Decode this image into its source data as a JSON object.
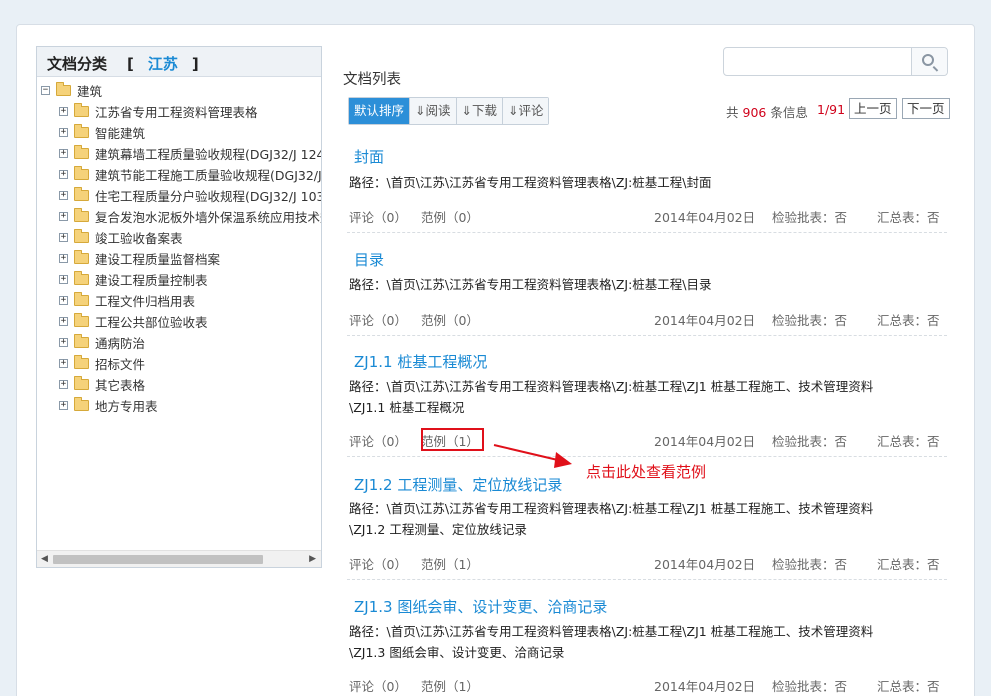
{
  "sidebar": {
    "heading": "文档分类",
    "bracket_open": "[",
    "province": "江苏",
    "bracket_close": "]",
    "root": {
      "label": "建筑",
      "toggle": "−"
    },
    "items": [
      {
        "label": "江苏省专用工程资料管理表格",
        "toggle": "+"
      },
      {
        "label": "智能建筑",
        "toggle": "+"
      },
      {
        "label": "建筑幕墙工程质量验收规程(DGJ32/J 124",
        "toggle": "+"
      },
      {
        "label": "建筑节能工程施工质量验收规程(DGJ32/J",
        "toggle": "+"
      },
      {
        "label": "住宅工程质量分户验收规程(DGJ32/J 103",
        "toggle": "+"
      },
      {
        "label": "复合发泡水泥板外墙外保温系统应用技术规",
        "toggle": "+"
      },
      {
        "label": "竣工验收备案表",
        "toggle": "+"
      },
      {
        "label": "建设工程质量监督档案",
        "toggle": "+"
      },
      {
        "label": "建设工程质量控制表",
        "toggle": "+"
      },
      {
        "label": "工程文件归档用表",
        "toggle": "+"
      },
      {
        "label": "工程公共部位验收表",
        "toggle": "+"
      },
      {
        "label": "通病防治",
        "toggle": "+"
      },
      {
        "label": "招标文件",
        "toggle": "+"
      },
      {
        "label": "其它表格",
        "toggle": "+"
      },
      {
        "label": "地方专用表",
        "toggle": "+"
      }
    ],
    "scroll_left": "◀",
    "scroll_right": "▶"
  },
  "main": {
    "title": "文档列表",
    "search": {
      "placeholder": "",
      "value": ""
    },
    "sort_tabs": [
      {
        "label": "默认排序"
      },
      {
        "label": "⇓阅读"
      },
      {
        "label": "⇓下载"
      },
      {
        "label": "⇓评论"
      }
    ],
    "pager": {
      "prefix": "共",
      "total": "906",
      "suffix": "条信息",
      "page": "1/91",
      "prev": "上一页",
      "next": "下一页"
    },
    "documents": [
      {
        "title": "封面",
        "path_lines": [
          "路径：\\首页\\江苏\\江苏省专用工程资料管理表格\\ZJ:桩基工程\\封面"
        ],
        "comments": "评论（0）",
        "examples": "范例（0）",
        "date": "2014年04月02日",
        "check": "检验批表：否",
        "summary": "汇总表：否"
      },
      {
        "title": "目录",
        "path_lines": [
          "路径：\\首页\\江苏\\江苏省专用工程资料管理表格\\ZJ:桩基工程\\目录"
        ],
        "comments": "评论（0）",
        "examples": "范例（0）",
        "date": "2014年04月02日",
        "check": "检验批表：否",
        "summary": "汇总表：否"
      },
      {
        "title": "ZJ1.1 桩基工程概况",
        "path_lines": [
          "路径：\\首页\\江苏\\江苏省专用工程资料管理表格\\ZJ:桩基工程\\ZJ1 桩基工程施工、技术管理资料",
          "\\ZJ1.1 桩基工程概况"
        ],
        "comments": "评论（0）",
        "examples": "范例（1）",
        "date": "2014年04月02日",
        "check": "检验批表：否",
        "summary": "汇总表：否"
      },
      {
        "title": "ZJ1.2 工程测量、定位放线记录",
        "path_lines": [
          "路径：\\首页\\江苏\\江苏省专用工程资料管理表格\\ZJ:桩基工程\\ZJ1 桩基工程施工、技术管理资料",
          "\\ZJ1.2 工程测量、定位放线记录"
        ],
        "comments": "评论（0）",
        "examples": "范例（1）",
        "date": "2014年04月02日",
        "check": "检验批表：否",
        "summary": "汇总表：否"
      },
      {
        "title": "ZJ1.3 图纸会审、设计变更、洽商记录",
        "path_lines": [
          "路径：\\首页\\江苏\\江苏省专用工程资料管理表格\\ZJ:桩基工程\\ZJ1 桩基工程施工、技术管理资料",
          "\\ZJ1.3 图纸会审、设计变更、洽商记录"
        ],
        "comments": "评论（0）",
        "examples": "范例（1）",
        "date": "2014年04月02日",
        "check": "检验批表：否",
        "summary": "汇总表：否"
      }
    ]
  },
  "annotation": {
    "text": "点击此处查看范例",
    "color": "#e0101a"
  },
  "colors": {
    "accent": "#1a8ad4",
    "active_tab": "#2c8fd8",
    "highlight": "#d0021b"
  }
}
